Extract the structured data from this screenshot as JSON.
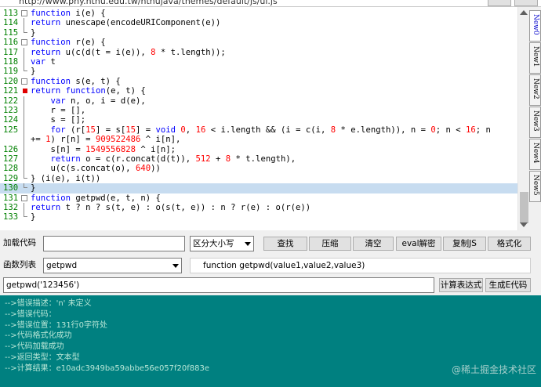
{
  "url": "http://www.phy.ntnu.edu.tw/ntnujava/themes/default/js/ui.js",
  "code_lines": [
    {
      "n": "113",
      "text": "function i(e) {"
    },
    {
      "n": "114",
      "text": "return unescape(encodeURIComponent(e))"
    },
    {
      "n": "115",
      "text": "}"
    },
    {
      "n": "116",
      "text": "function r(e) {"
    },
    {
      "n": "117",
      "text": "return u(c(d(t = i(e)), 8 * t.length));"
    },
    {
      "n": "118",
      "text": "var t"
    },
    {
      "n": "119",
      "text": "}"
    },
    {
      "n": "120",
      "text": "function s(e, t) {"
    },
    {
      "n": "121",
      "text": "return function(e, t) {"
    },
    {
      "n": "122",
      "text": "    var n, o, i = d(e),"
    },
    {
      "n": "123",
      "text": "    r = [],"
    },
    {
      "n": "124",
      "text": "    s = [];"
    },
    {
      "n": "125",
      "text": "    for (r[15] = s[15] = void 0, 16 < i.length && (i = c(i, 8 * e.length)), n = 0; n < 16; n"
    },
    {
      "n": "",
      "text": "+= 1) r[n] = 909522486 ^ i[n],"
    },
    {
      "n": "126",
      "text": "    s[n] = 1549556828 ^ i[n];"
    },
    {
      "n": "127",
      "text": "    return o = c(r.concat(d(t)), 512 + 8 * t.length),"
    },
    {
      "n": "128",
      "text": "    u(c(s.concat(o), 640))"
    },
    {
      "n": "129",
      "text": "} (i(e), i(t))"
    },
    {
      "n": "130",
      "text": "}"
    },
    {
      "n": "131",
      "text": "function getpwd(e, t, n) {"
    },
    {
      "n": "132",
      "text": "return t ? n ? s(t, e) : o(s(t, e)) : n ? r(e) : o(r(e))"
    },
    {
      "n": "133",
      "text": "}"
    }
  ],
  "right_tabs": [
    "New0",
    "New1",
    "New2",
    "New3",
    "New4",
    "New5"
  ],
  "toolbar": {
    "load_code_label": "加载代码",
    "load_code_value": "",
    "case_select_value": "区分大小写",
    "find_label": "查找",
    "compress_label": "压缩",
    "clear_label": "清空",
    "eval_decrypt_label": "eval解密",
    "copy_js_label": "复制JS",
    "format_label": "格式化"
  },
  "func_row": {
    "label": "函数列表",
    "selected": "getpwd",
    "signature": "function getpwd(value1,value2,value3)"
  },
  "expr_row": {
    "expression": "getpwd('123456')",
    "calc_label": "计算表达式",
    "gen_label": "生成E代码"
  },
  "console_lines": [
    "-->错误描述：'n' 未定义",
    "-->错误代码：",
    "-->错误位置：131行0字符处",
    "-->代码格式化成功",
    "-->代码加载成功",
    "-->返回类型：文本型",
    "-->计算结果：e10adc3949ba59abbe56e057f20f883e"
  ],
  "watermark": "@稀土掘金技术社区",
  "colors": {
    "line_number": "#008000",
    "keyword": "#0000ff",
    "number": "#ff0000",
    "highlight_line": "#c7dcf0",
    "console_bg": "#008080",
    "console_text": "#b7e6d6"
  }
}
